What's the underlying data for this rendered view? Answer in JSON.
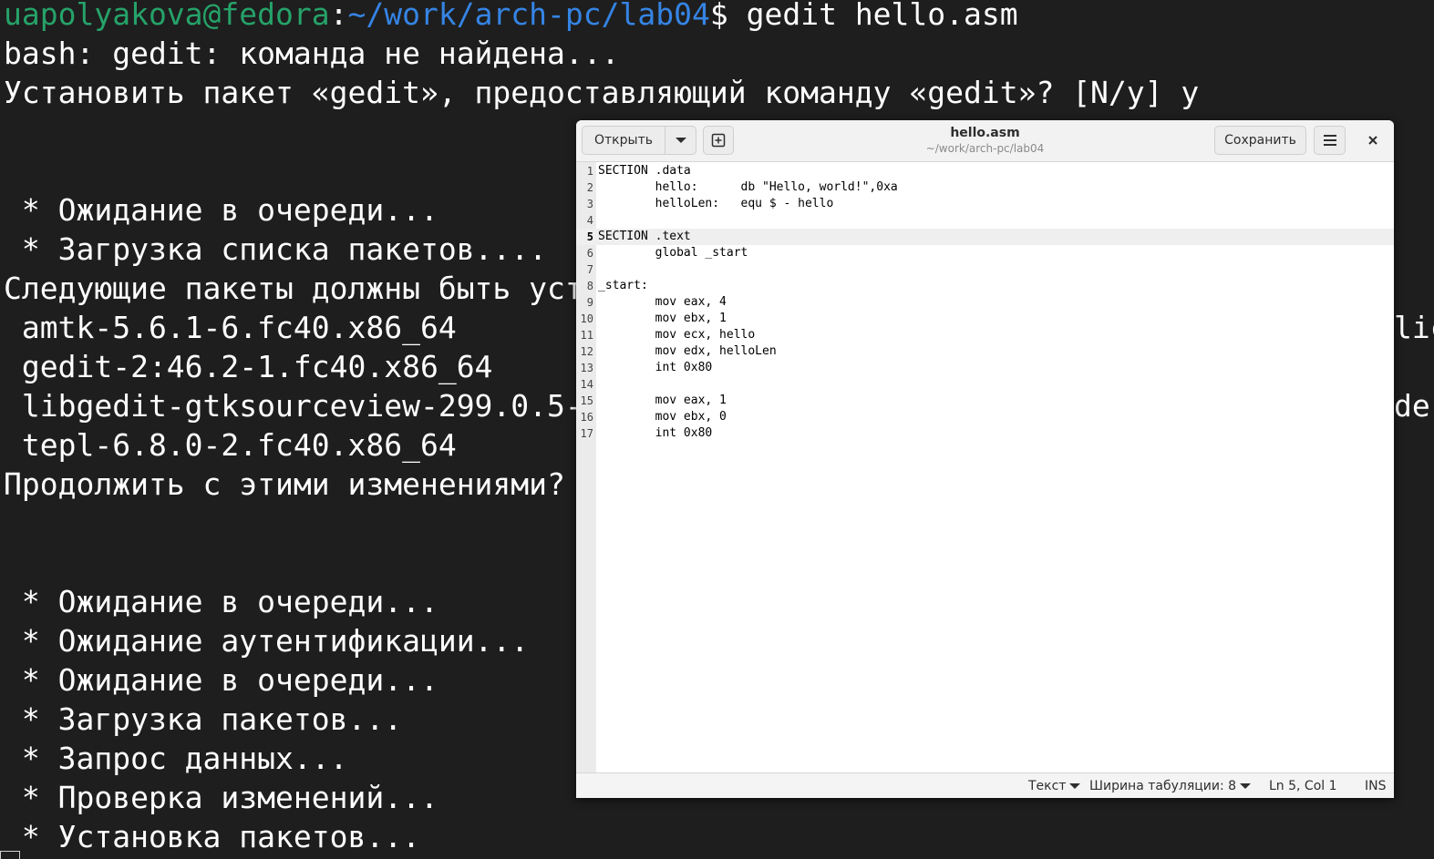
{
  "terminal": {
    "prompt_user": "uapolyakova@fedora",
    "prompt_colon": ":",
    "prompt_path": "~/work/arch-pc/lab04",
    "prompt_symbol": "$ ",
    "command": "gedit hello.asm",
    "lines": [
      "bash: gedit: команда не найдена...",
      "Установить пакет «gedit», предоставляющий команду «gedit»? [N/y] y",
      "",
      "",
      " * Ожидание в очереди...",
      " * Загрузка списка пакетов....",
      "Следующие пакеты должны быть уст",
      " amtk-5.6.1-6.fc40.x86_64",
      " gedit-2:46.2-1.fc40.x86_64",
      " libgedit-gtksourceview-299.0.5-",
      " tepl-6.8.0-2.fc40.x86_64",
      "Продолжить с этими изменениями?",
      "",
      "",
      " * Ожидание в очереди...",
      " * Ожидание аутентификации...",
      " * Ожидание в очереди...",
      " * Загрузка пакетов...",
      " * Запрос данных...",
      " * Проверка изменений...",
      " * Установка пакетов..."
    ],
    "right_fragments": {
      "amtk_tail": "lic",
      "libgedit_tail": "de"
    }
  },
  "gedit": {
    "open_label": "Открыть",
    "save_label": "Сохранить",
    "title": "hello.asm",
    "subtitle": "~/work/arch-pc/lab04",
    "current_line": 5,
    "code": [
      {
        "n": "1",
        "text": "SECTION .data"
      },
      {
        "n": "2",
        "text": "        hello:      db \"Hello, world!\",0xa"
      },
      {
        "n": "3",
        "text": "        helloLen:   equ $ - hello"
      },
      {
        "n": "4",
        "text": ""
      },
      {
        "n": "5",
        "text": "SECTION .text"
      },
      {
        "n": "6",
        "text": "        global _start"
      },
      {
        "n": "7",
        "text": ""
      },
      {
        "n": "8",
        "text": "_start:"
      },
      {
        "n": "9",
        "text": "        mov eax, 4"
      },
      {
        "n": "10",
        "text": "        mov ebx, 1"
      },
      {
        "n": "11",
        "text": "        mov ecx, hello"
      },
      {
        "n": "12",
        "text": "        mov edx, helloLen"
      },
      {
        "n": "13",
        "text": "        int 0x80"
      },
      {
        "n": "14",
        "text": ""
      },
      {
        "n": "15",
        "text": "        mov eax, 1"
      },
      {
        "n": "16",
        "text": "        mov ebx, 0"
      },
      {
        "n": "17",
        "text": "        int 0x80"
      }
    ],
    "status": {
      "language": "Текст",
      "tab_width": "Ширина табуляции: 8",
      "position": "Ln 5, Col 1",
      "mode": "INS"
    }
  },
  "colors": {
    "terminal_bg": "#1e1e1e",
    "prompt_user": "#26a269",
    "prompt_path": "#3584e4"
  }
}
